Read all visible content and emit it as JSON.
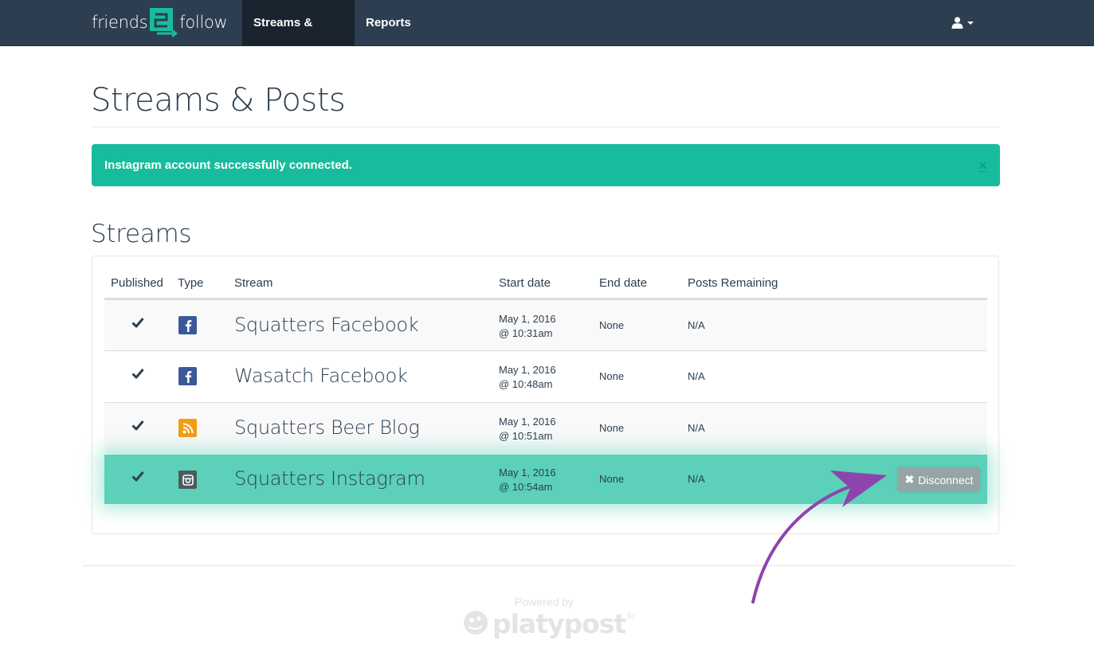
{
  "navbar": {
    "brand_left": "friends",
    "brand_mark": "2",
    "brand_right": "follow",
    "items": [
      {
        "label": "Streams & Posts",
        "active": true
      },
      {
        "label": "Reports",
        "active": false
      }
    ],
    "user_icon": "user-icon"
  },
  "page": {
    "title": "Streams & Posts"
  },
  "alert": {
    "message": "Instagram account successfully connected.",
    "close": "×",
    "color": "#18bc9c"
  },
  "streams": {
    "title": "Streams",
    "columns": [
      "Published",
      "Type",
      "Stream",
      "Start date",
      "End date",
      "Posts Remaining"
    ],
    "rows": [
      {
        "published": "✔",
        "type": "facebook-icon",
        "name": "Squatters Facebook",
        "start_date": "May 1, 2016",
        "start_time": "@ 10:31am",
        "end_date": "None",
        "remaining": "N/A"
      },
      {
        "published": "✔",
        "type": "facebook-icon",
        "name": "Wasatch Facebook",
        "start_date": "May 1, 2016",
        "start_time": "@ 10:48am",
        "end_date": "None",
        "remaining": "N/A"
      },
      {
        "published": "✔",
        "type": "rss-icon",
        "name": "Squatters Beer Blog",
        "start_date": "May 1, 2016",
        "start_time": "@ 10:51am",
        "end_date": "None",
        "remaining": "N/A"
      },
      {
        "published": "✔",
        "type": "instagram-icon",
        "name": "Squatters Instagram",
        "start_date": "May 1, 2016",
        "start_time": "@ 10:54am",
        "end_date": "None",
        "remaining": "N/A"
      }
    ],
    "disconnect_label": "Disconnect",
    "highlight_color": "#5cd0b9"
  },
  "footer": {
    "powered_by": "Powered by",
    "brand": "platypost",
    "suffix": "llc"
  },
  "colors": {
    "navbar": "#2c3e50",
    "accent": "#18bc9c",
    "annotation_arrow": "#8e44ad"
  }
}
